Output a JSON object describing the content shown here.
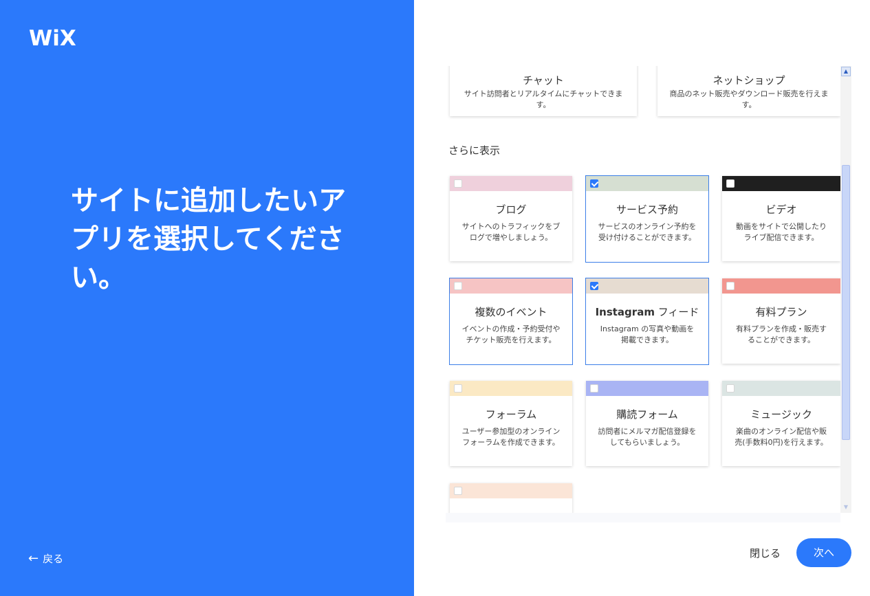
{
  "brand": {
    "logo": "WiX"
  },
  "left": {
    "headline": "サイトに追加したいアプリを選択してください。",
    "back_label": "戻る"
  },
  "top_cards": [
    {
      "title": "チャット",
      "desc": "サイト訪問者とリアルタイムにチャットできます。"
    },
    {
      "title": "ネットショップ",
      "desc": "商品のネット販売やダウンロード販売を行えます。"
    }
  ],
  "more_label": "さらに表示",
  "cards": [
    {
      "title": "ブログ",
      "desc": "サイトへのトラフィックをブログで増やしましょう。",
      "color": "#efd0dc",
      "checked": false
    },
    {
      "title": "サービス予約",
      "desc": "サービスのオンライン予約を受け付けることができます。",
      "color": "#d6dfd2",
      "checked": true
    },
    {
      "title": "ビデオ",
      "desc": "動画をサイトで公開したりライブ配信できます。",
      "color": "#1f1f1f",
      "checked": false
    },
    {
      "title": "複数のイベント",
      "desc": "イベントの作成・予約受付やチケット販売を行えます。",
      "color": "#f6c4c4",
      "checked": false
    },
    {
      "title_bold": "Instagram",
      "title_rest": " フィード",
      "desc": "Instagram の写真や動画を掲載できます。",
      "color": "#e6dcd1",
      "checked": true
    },
    {
      "title": "有料プラン",
      "desc": "有料プランを作成・販売することができます。",
      "color": "#f2968f",
      "checked": false
    },
    {
      "title": "フォーラム",
      "desc": "ユーザー参加型のオンラインフォーラムを作成できます。",
      "color": "#fbe9c4",
      "checked": false
    },
    {
      "title": "購読フォーム",
      "desc": "訪問者にメルマガ配信登録をしてもらいましょう。",
      "color": "#a9b4f4",
      "checked": false
    },
    {
      "title": "ミュージック",
      "desc": "楽曲のオンライン配信や販売(手数料0円)を行えます。",
      "color": "#dbe5e3",
      "checked": false
    },
    {
      "title": "",
      "desc": "",
      "color": "#fbe5d7",
      "checked": false
    }
  ],
  "footer": {
    "close_label": "閉じる",
    "next_label": "次へ"
  }
}
